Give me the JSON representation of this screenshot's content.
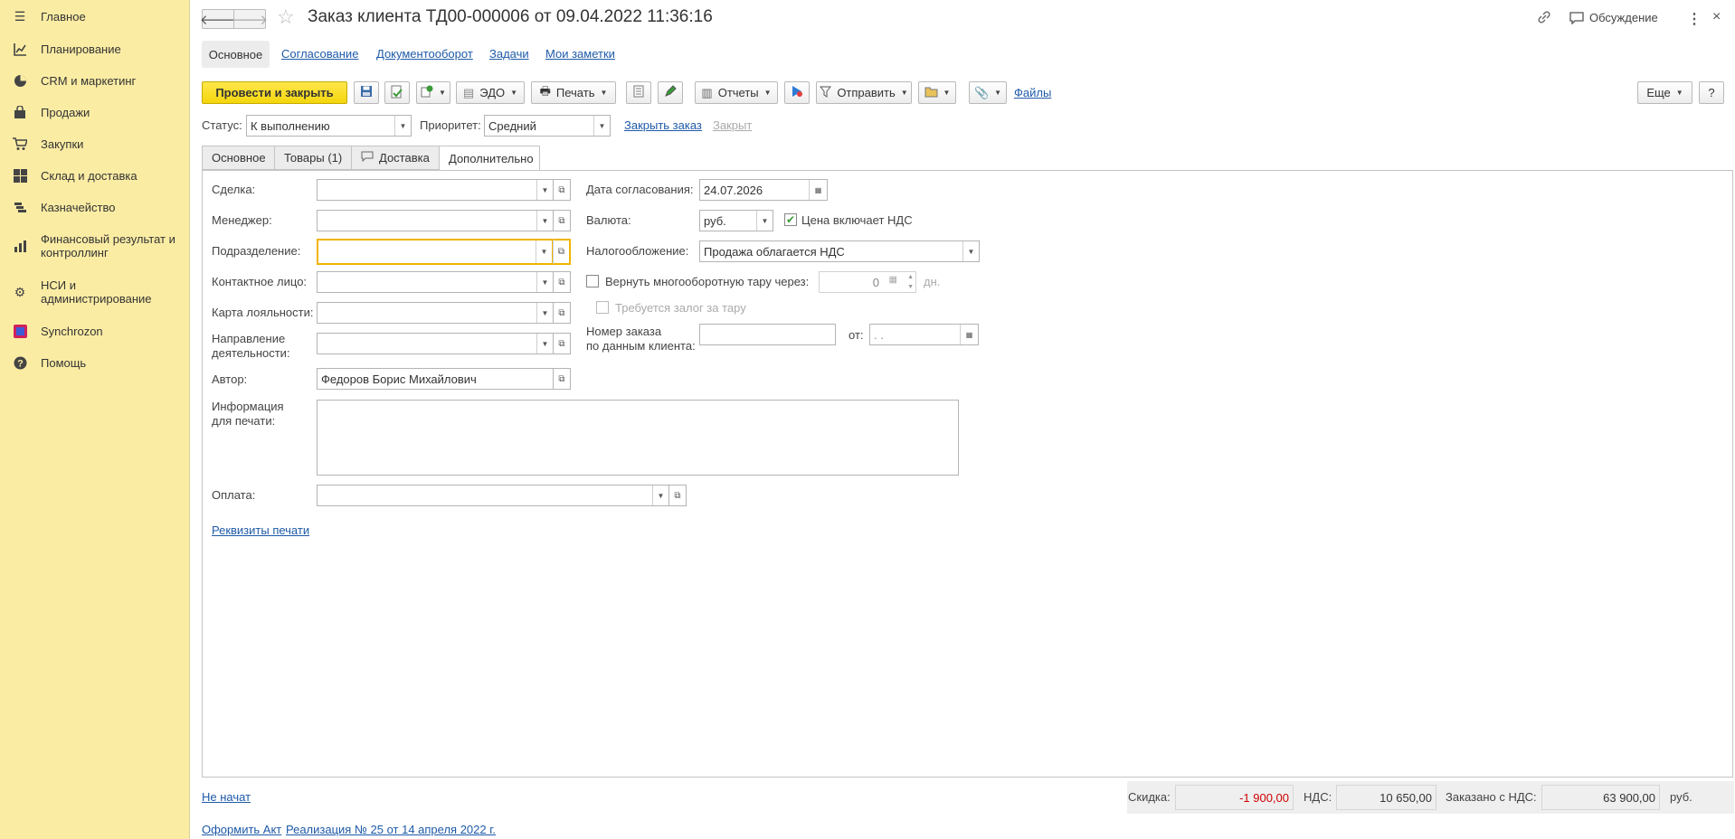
{
  "sidebar": {
    "items": [
      {
        "label": "Главное",
        "icon": "menu-icon"
      },
      {
        "label": "Планирование",
        "icon": "chart-icon"
      },
      {
        "label": "CRM и маркетинг",
        "icon": "pie-icon"
      },
      {
        "label": "Продажи",
        "icon": "bag-icon"
      },
      {
        "label": "Закупки",
        "icon": "cart-icon"
      },
      {
        "label": "Склад и доставка",
        "icon": "grid-icon"
      },
      {
        "label": "Казначейство",
        "icon": "treasury-icon"
      },
      {
        "label": "Финансовый результат и контроллинг",
        "icon": "bar-chart-icon"
      },
      {
        "label": "НСИ и администрирование",
        "icon": "gear-icon"
      },
      {
        "label": "Synchrozon",
        "icon": "synchrozon-icon"
      },
      {
        "label": "Помощь",
        "icon": "help-icon"
      }
    ]
  },
  "header": {
    "title": "Заказ клиента ТД00-000006 от 09.04.2022 11:36:16",
    "discussion": "Обсуждение"
  },
  "nav_tabs": [
    "Основное",
    "Согласование",
    "Документооборот",
    "Задачи",
    "Мои заметки"
  ],
  "toolbar": {
    "post_close": "Провести и закрыть",
    "edo": "ЭДО",
    "print": "Печать",
    "reports": "Отчеты",
    "send": "Отправить",
    "files": "Файлы",
    "more": "Еще",
    "help": "?"
  },
  "status_row": {
    "status_label": "Статус:",
    "status_value": "К выполнению",
    "priority_label": "Приоритет:",
    "priority_value": "Средний",
    "close_order": "Закрыть заказ",
    "closed": "Закрыт"
  },
  "form_tabs": [
    "Основное",
    "Товары (1)",
    "Доставка",
    "Дополнительно"
  ],
  "form": {
    "deal_label": "Сделка:",
    "manager_label": "Менеджер:",
    "division_label": "Подразделение:",
    "contact_label": "Контактное лицо:",
    "loyalty_label": "Карта лояльности:",
    "direction_label1": "Направление",
    "direction_label2": "деятельности:",
    "author_label": "Автор:",
    "author_value": "Федоров Борис Михайлович",
    "print_info_label1": "Информация",
    "print_info_label2": "для печати:",
    "payment_label": "Оплата:",
    "print_details_link": "Реквизиты печати",
    "approval_date_label": "Дата согласования:",
    "approval_date_value": "24.07.2026",
    "currency_label": "Валюта:",
    "currency_value": "руб.",
    "price_incl_vat": "Цена включает НДС",
    "taxation_label": "Налогообложение:",
    "taxation_value": "Продажа облагается НДС",
    "return_tare": "Вернуть многооборотную тару через:",
    "return_days": "0",
    "days_unit": "дн.",
    "deposit_required": "Требуется залог за тару",
    "client_order_label1": "Номер заказа",
    "client_order_label2": "по данным клиента:",
    "from_label": "от:",
    "from_date_placeholder": " .  ."
  },
  "footer": {
    "not_started": "Не начат",
    "act_link": "Оформить Акт",
    "realization_link": "Реализация № 25 от 14 апреля 2022 г.",
    "discount_label": "Скидка:",
    "discount_value": "-1 900,00",
    "vat_label": "НДС:",
    "vat_value": "10 650,00",
    "ordered_label": "Заказано с НДС:",
    "ordered_value": "63 900,00",
    "currency": "руб."
  },
  "colors": {
    "sidebar_bg": "#fbeca4",
    "primary_button": "#f4d60d",
    "link": "#1e5aa8",
    "discount_red": "#d00000",
    "focus_border": "#f0b400"
  }
}
